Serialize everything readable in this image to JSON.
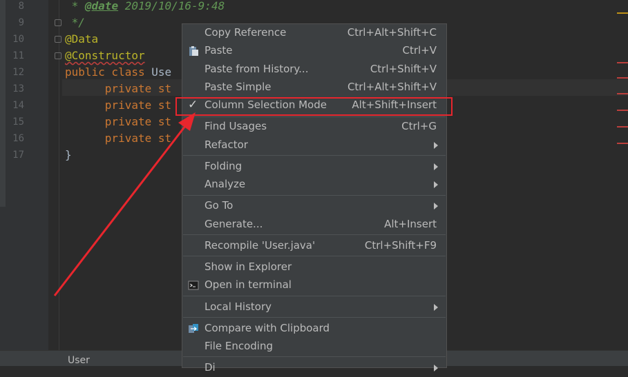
{
  "editor": {
    "line_numbers": [
      "8",
      "9",
      "10",
      "11",
      "12",
      "13",
      "14",
      "15",
      "16",
      "17"
    ],
    "lines": {
      "l8_star": " * ",
      "l8_tag": "@date",
      "l8_rest": " 2019/10/16-9:48",
      "l9": " */",
      "l10": "@Data",
      "l11": "@Constructor",
      "l12_kw": "public class ",
      "l12_name": "Use",
      "l13": "      private st",
      "l14": "      private st",
      "l15": "      private st",
      "l16": "      private st",
      "l17": "}"
    }
  },
  "status_bar": {
    "tab": "User"
  },
  "context_menu": {
    "items": [
      {
        "label": "Copy Reference",
        "shortcut": "Ctrl+Alt+Shift+C"
      },
      {
        "label": "Paste",
        "shortcut": "Ctrl+V",
        "icon": "clipboard-icon"
      },
      {
        "label": "Paste from History...",
        "shortcut": "Ctrl+Shift+V"
      },
      {
        "label": "Paste Simple",
        "shortcut": "Ctrl+Alt+Shift+V"
      },
      {
        "label": "Column Selection Mode",
        "shortcut": "Alt+Shift+Insert",
        "checked": true,
        "icon": "checkmark-icon"
      },
      {
        "label": "Find Usages",
        "shortcut": "Ctrl+G"
      },
      {
        "label": "Refactor",
        "shortcut": "",
        "submenu": true
      },
      {
        "label": "Folding",
        "shortcut": "",
        "submenu": true
      },
      {
        "label": "Analyze",
        "shortcut": "",
        "submenu": true
      },
      {
        "label": "Go To",
        "shortcut": "",
        "submenu": true
      },
      {
        "label": "Generate...",
        "shortcut": "Alt+Insert"
      },
      {
        "label": "Recompile 'User.java'",
        "shortcut": "Ctrl+Shift+F9"
      },
      {
        "label": "Show in Explorer",
        "shortcut": ""
      },
      {
        "label": "Open in terminal",
        "shortcut": "",
        "icon": "terminal-icon"
      },
      {
        "label": "Local History",
        "shortcut": "",
        "submenu": true
      },
      {
        "label": "Compare with Clipboard",
        "shortcut": "",
        "icon": "compare-icon"
      },
      {
        "label": "File Encoding",
        "shortcut": ""
      },
      {
        "label": "Di",
        "shortcut": "",
        "submenu": true
      }
    ]
  },
  "colors": {
    "editor_bg": "#2b2b2b",
    "menu_bg": "#3c3f41",
    "highlight": "#e8262d",
    "keyword": "#cc7832",
    "annotation": "#bbb529",
    "doc_comment": "#629755"
  }
}
